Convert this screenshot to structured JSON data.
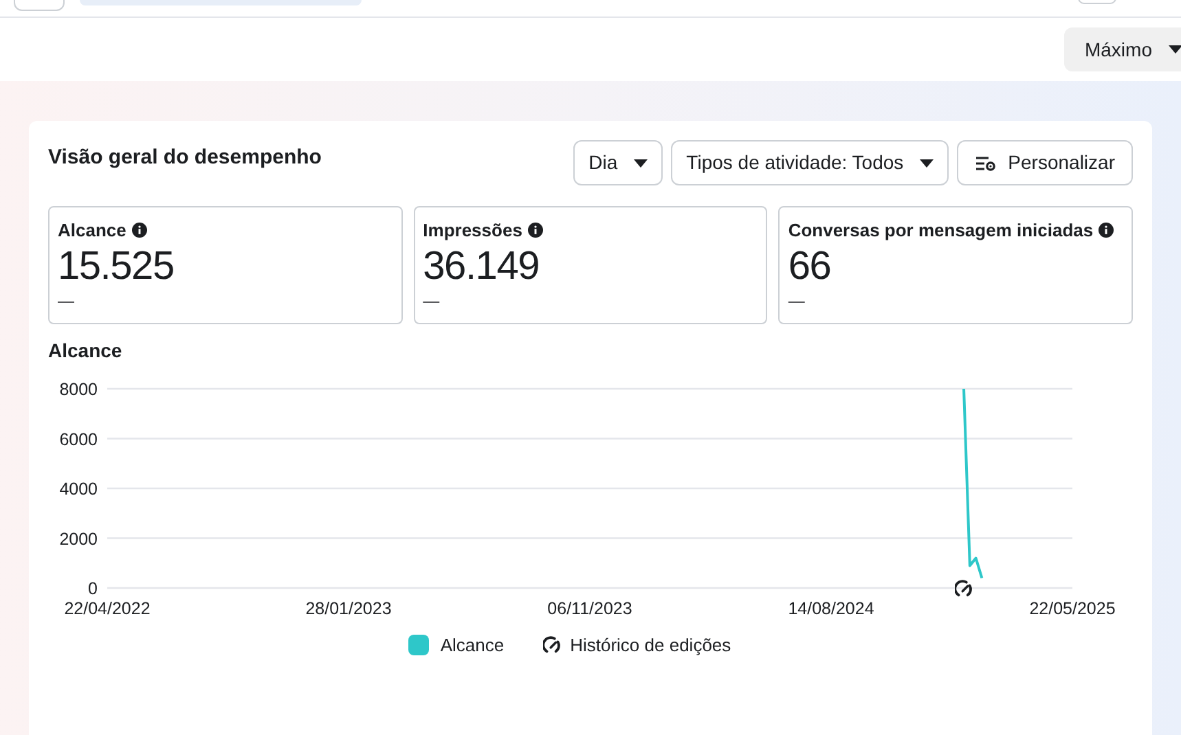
{
  "filter": {
    "label": "Máximo"
  },
  "panel": {
    "title": "Visão geral do desempenho",
    "controls": [
      {
        "kind": "dropdown",
        "label": "Dia"
      },
      {
        "kind": "dropdown",
        "label": "Tipos de atividade: Todos"
      },
      {
        "kind": "customize",
        "label": "Personalizar"
      }
    ],
    "metrics": [
      {
        "label": "Alcance",
        "value": "15.525",
        "change": "—"
      },
      {
        "label": "Impressões",
        "value": "36.149",
        "change": "—"
      },
      {
        "label": "Conversas por mensagem iniciadas",
        "value": "66",
        "change": "—"
      }
    ],
    "chart_title": "Alcance",
    "chart_data": {
      "type": "line",
      "categories": [
        "22/04/2022",
        null,
        null,
        null,
        null,
        null,
        null,
        null,
        null,
        null,
        null,
        null,
        null,
        null,
        null,
        null,
        null,
        null,
        null,
        null,
        null,
        null,
        null,
        null,
        null,
        null,
        null,
        null,
        null,
        null,
        null,
        null,
        null,
        null,
        null,
        null,
        null,
        null,
        null,
        null,
        "28/01/2023",
        null,
        null,
        null,
        null,
        null,
        null,
        null,
        null,
        null,
        null,
        null,
        null,
        null,
        null,
        null,
        null,
        null,
        null,
        null,
        null,
        null,
        null,
        null,
        null,
        null,
        null,
        null,
        null,
        null,
        null,
        null,
        null,
        null,
        null,
        null,
        null,
        null,
        null,
        null,
        "06/11/2023",
        null,
        null,
        null,
        null,
        null,
        null,
        null,
        null,
        null,
        null,
        null,
        null,
        null,
        null,
        null,
        null,
        null,
        null,
        null,
        null,
        null,
        null,
        null,
        null,
        null,
        null,
        null,
        null,
        null,
        null,
        null,
        null,
        null,
        null,
        null,
        null,
        null,
        null,
        null,
        "14/08/2024",
        null,
        null,
        null,
        null,
        null,
        null,
        null,
        null,
        null,
        null,
        null,
        null,
        null,
        null,
        null,
        null,
        null,
        null,
        null,
        null,
        null,
        null,
        null,
        null,
        null,
        null,
        null,
        null,
        null,
        null,
        null,
        null,
        null,
        null,
        null,
        null,
        null,
        null,
        null,
        "22/05/2025"
      ],
      "series": [
        {
          "name": "Alcance",
          "color": "#2ec7c9",
          "values": [
            null,
            null,
            null,
            null,
            null,
            null,
            null,
            null,
            null,
            null,
            null,
            null,
            null,
            null,
            null,
            null,
            null,
            null,
            null,
            null,
            null,
            null,
            null,
            null,
            null,
            null,
            null,
            null,
            null,
            null,
            null,
            null,
            null,
            null,
            null,
            null,
            null,
            null,
            null,
            null,
            null,
            null,
            null,
            null,
            null,
            null,
            null,
            null,
            null,
            null,
            null,
            null,
            null,
            null,
            null,
            null,
            null,
            null,
            null,
            null,
            null,
            null,
            null,
            null,
            null,
            null,
            null,
            null,
            null,
            null,
            null,
            null,
            null,
            null,
            null,
            null,
            null,
            null,
            null,
            null,
            null,
            null,
            null,
            null,
            null,
            null,
            null,
            null,
            null,
            null,
            null,
            null,
            null,
            null,
            null,
            null,
            null,
            null,
            null,
            null,
            null,
            null,
            null,
            null,
            null,
            null,
            null,
            null,
            null,
            null,
            null,
            null,
            null,
            null,
            null,
            null,
            null,
            null,
            null,
            null,
            null,
            null,
            null,
            null,
            null,
            null,
            null,
            null,
            null,
            null,
            null,
            null,
            null,
            null,
            null,
            null,
            null,
            null,
            null,
            null,
            null,
            null,
            8000,
            900,
            1200,
            400,
            null,
            null,
            null,
            null,
            null,
            null,
            null,
            null,
            null,
            null,
            null,
            null,
            null,
            null,
            null
          ]
        }
      ],
      "ylim": [
        0,
        8000
      ],
      "yticks": [
        0,
        2000,
        4000,
        6000,
        8000
      ],
      "grid": true
    },
    "edit_history_label": "Histórico de edições"
  }
}
